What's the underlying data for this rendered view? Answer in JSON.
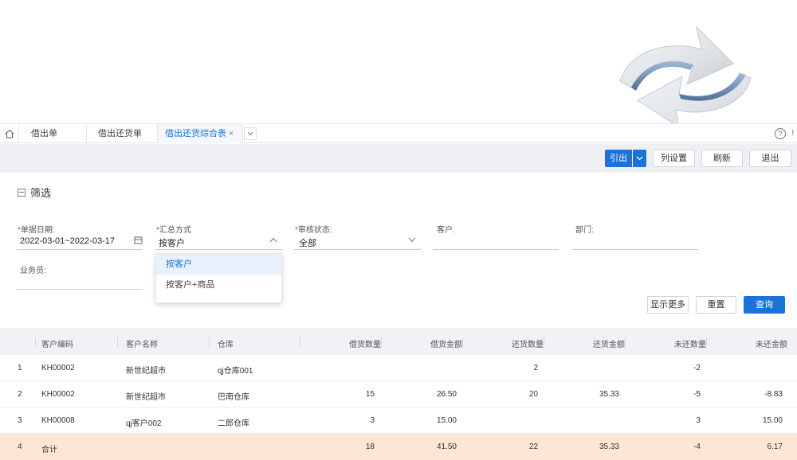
{
  "tabs": [
    {
      "label": "借出单",
      "active": false
    },
    {
      "label": "借出还货单",
      "active": false
    },
    {
      "label": "借出还货综合表",
      "active": true
    }
  ],
  "tab_close_glyph": "×",
  "toolbar": {
    "export_label": "引出",
    "column_settings_label": "列设置",
    "refresh_label": "刷新",
    "exit_label": "退出"
  },
  "filter": {
    "title": "筛选",
    "date": {
      "label": "单据日期:",
      "value": "2022-03-01~2022-03-17"
    },
    "summary": {
      "label": "汇总方式",
      "value": "按客户"
    },
    "audit": {
      "label": "审核状态:",
      "value": "全部"
    },
    "customer": {
      "label": "客户:",
      "value": ""
    },
    "department": {
      "label": "部门:",
      "value": ""
    },
    "salesperson": {
      "label": "业务员:",
      "value": ""
    },
    "summary_options": [
      "按客户",
      "按客户+商品"
    ],
    "show_more_label": "显示更多",
    "reset_label": "重置",
    "query_label": "查询"
  },
  "grid": {
    "columns": [
      "客户编码",
      "客户名称",
      "仓库",
      "借货数量",
      "借货金额",
      "还货数量",
      "还货金额",
      "未还数量",
      "未还金额"
    ],
    "rows": [
      {
        "idx": "1",
        "code": "KH00002",
        "name": "新世纪超市",
        "warehouse": "qj仓库001",
        "borrow_qty": "",
        "borrow_amt": "",
        "return_qty": "2",
        "return_amt": "",
        "unreturned_qty": "-2",
        "unreturned_amt": ""
      },
      {
        "idx": "2",
        "code": "KH00002",
        "name": "新世纪超市",
        "warehouse": "巴南仓库",
        "borrow_qty": "15",
        "borrow_amt": "26.50",
        "return_qty": "20",
        "return_amt": "35.33",
        "unreturned_qty": "-5",
        "unreturned_amt": "-8.83"
      },
      {
        "idx": "3",
        "code": "KH00008",
        "name": "qj客户002",
        "warehouse": "二郎仓库",
        "borrow_qty": "3",
        "borrow_amt": "15.00",
        "return_qty": "",
        "return_amt": "",
        "unreturned_qty": "3",
        "unreturned_amt": "15.00"
      }
    ],
    "total": {
      "idx": "4",
      "label": "合计",
      "borrow_qty": "18",
      "borrow_amt": "41.50",
      "return_qty": "22",
      "return_amt": "35.33",
      "unreturned_qty": "-4",
      "unreturned_amt": "6.17"
    }
  },
  "colors": {
    "primary": "#1a73d9",
    "total_row": "#fde7d4",
    "toolbar_bg": "#eef0f4"
  },
  "icons": [
    "refresh-arrows-icon",
    "home-icon",
    "chevron-down-icon",
    "help-icon",
    "calendar-icon",
    "chevron-up-icon",
    "collapse-icon"
  ]
}
